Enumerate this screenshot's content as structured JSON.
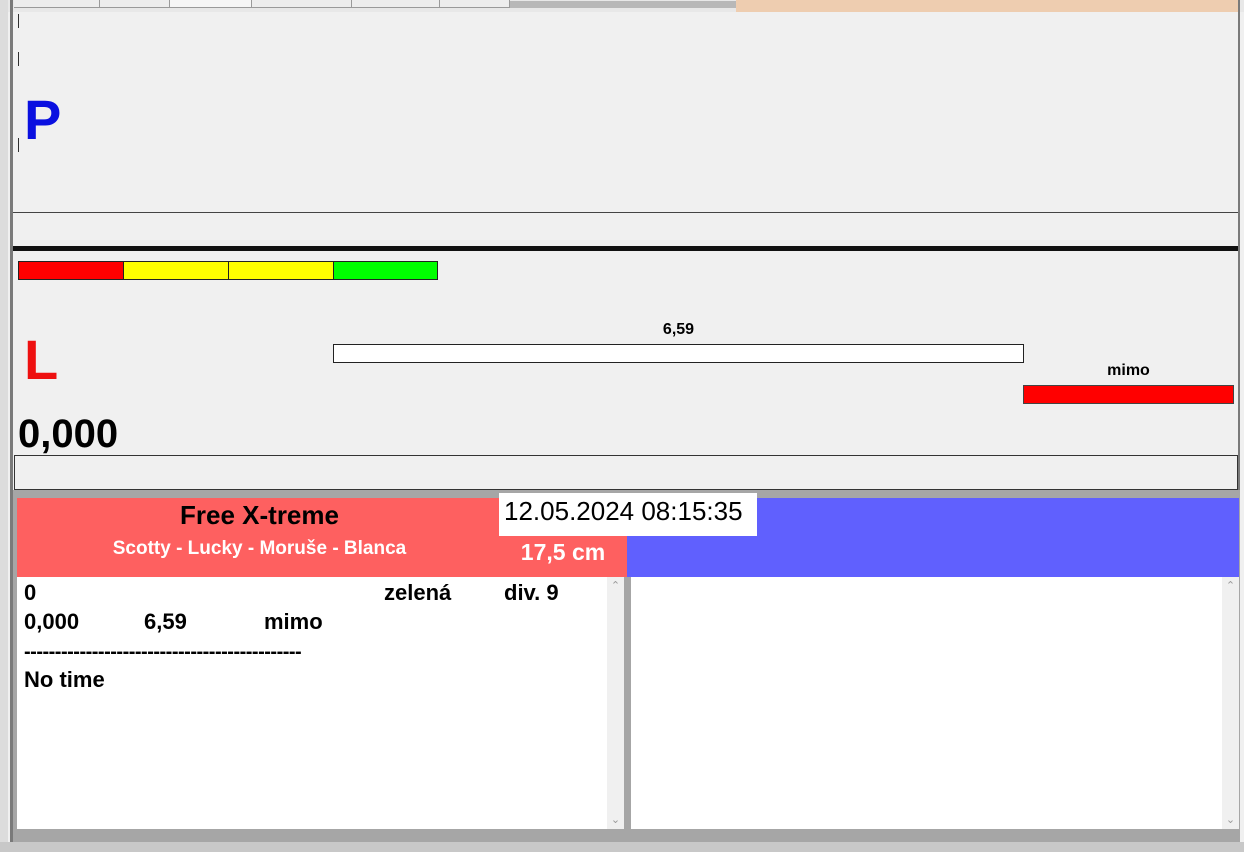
{
  "lanes": {
    "p_label": "P",
    "l_label": "L"
  },
  "signal_bar": {
    "segments": [
      {
        "color": "#ff0000"
      },
      {
        "color": "#ffff00"
      },
      {
        "color": "#ffff00"
      },
      {
        "color": "#00ff00"
      }
    ]
  },
  "measurement": {
    "track_label": "6,59",
    "out_label": "mimo",
    "value": "0,000"
  },
  "run_header": {
    "event": "Free X-treme",
    "team": "Scotty - Lucky - Moruše - Blanca",
    "datetime": "12.05.2024 08:15:35",
    "height": "17,5 cm"
  },
  "log": {
    "line1": {
      "c1": "0",
      "c2": "zelená",
      "c3": "div. 9"
    },
    "line2": {
      "c1": "0,000",
      "c2": "6,59",
      "c3": "mimo"
    },
    "separator": "---------------------------------------------",
    "line3": "No time"
  },
  "colors": {
    "p_color": "#0a10e0",
    "l_color": "#ee1010",
    "header_red": "#fe6060",
    "header_blue": "#6060fe"
  },
  "icons": {
    "scroll_up": "chevron-up-icon",
    "scroll_down": "chevron-down-icon"
  }
}
